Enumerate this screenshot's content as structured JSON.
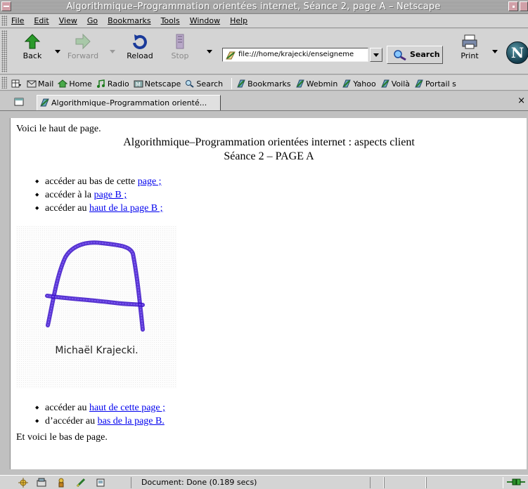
{
  "window": {
    "title": "Algorithmique–Programmation orientées internet, Séance 2, page A – Netscape"
  },
  "menu": [
    "File",
    "Edit",
    "View",
    "Go",
    "Bookmarks",
    "Tools",
    "Window",
    "Help"
  ],
  "menu_underline_index": [
    0,
    0,
    0,
    0,
    0,
    0,
    0,
    0
  ],
  "toolbar": {
    "back": "Back",
    "forward": "Forward",
    "reload": "Reload",
    "stop": "Stop",
    "url": "file:///home/krajecki/enseigneme",
    "search": "Search",
    "print": "Print"
  },
  "personal_toolbar": {
    "items": [
      "Mail",
      "Home",
      "Radio",
      "Netscape",
      "Search",
      "Bookmarks",
      "Webmin",
      "Yahoo",
      "Voilà",
      "Portail s"
    ]
  },
  "tab": {
    "label": "Algorithmique–Programmation orienté...",
    "close": "×"
  },
  "page": {
    "top_text": "Voici le haut de page.",
    "heading1": "Algorithmique–Programmation orientées internet : aspects client",
    "heading2": "Séance 2 – PAGE A",
    "list1": [
      {
        "prefix": "accéder au bas de cette ",
        "link": "page ;"
      },
      {
        "prefix": "accéder  à la ",
        "link": "page B ;"
      },
      {
        "prefix": "accéder au ",
        "link": "haut de la page B ;"
      }
    ],
    "image_caption": "Michaël Krajecki.",
    "list2": [
      {
        "prefix": "accéder au ",
        "link": "haut de cette page ;"
      },
      {
        "prefix": "d’accéder au ",
        "link": "bas de la page B."
      }
    ],
    "bottom_text": "Et voici le bas de page."
  },
  "status": {
    "text": "Document: Done (0.189 secs)"
  },
  "colors": {
    "link": "#0000ee",
    "signature_ink": "#4a17d6"
  }
}
